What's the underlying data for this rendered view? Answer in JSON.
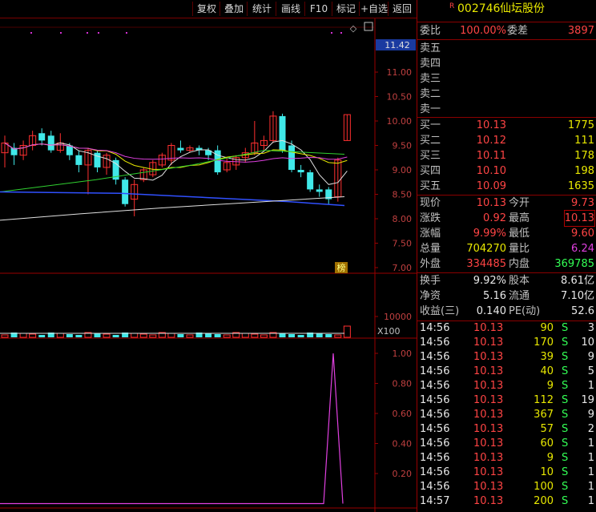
{
  "toolbar": {
    "buttons": [
      "复权",
      "叠加",
      "统计",
      "画线",
      "F10",
      "标记",
      "+自选",
      "返回"
    ]
  },
  "price_axis": {
    "current_price": "11.42",
    "ticks": [
      "11.00",
      "10.50",
      "10.00",
      "9.50",
      "9.00",
      "8.50",
      "8.00",
      "7.50",
      "7.00"
    ],
    "badge": "榜"
  },
  "volume_axis": {
    "tick": "10000",
    "unit": "X100"
  },
  "indicator_axis": {
    "ticks": [
      "1.00",
      "0.80",
      "0.60",
      "0.40",
      "0.20"
    ]
  },
  "stock": {
    "flag": "R",
    "code": "002746",
    "name": "仙坛股份"
  },
  "committee": {
    "ratio_label": "委比",
    "ratio_value": "100.00%",
    "diff_label": "委差",
    "diff_value": "3897"
  },
  "asks": [
    {
      "label": "卖五",
      "price": "",
      "vol": ""
    },
    {
      "label": "卖四",
      "price": "",
      "vol": ""
    },
    {
      "label": "卖三",
      "price": "",
      "vol": ""
    },
    {
      "label": "卖二",
      "price": "",
      "vol": ""
    },
    {
      "label": "卖一",
      "price": "",
      "vol": ""
    }
  ],
  "bids": [
    {
      "label": "买一",
      "price": "10.13",
      "vol": "1775"
    },
    {
      "label": "买二",
      "price": "10.12",
      "vol": "111"
    },
    {
      "label": "买三",
      "price": "10.11",
      "vol": "178"
    },
    {
      "label": "买四",
      "price": "10.10",
      "vol": "198"
    },
    {
      "label": "买五",
      "price": "10.09",
      "vol": "1635"
    }
  ],
  "quote": [
    {
      "l1": "现价",
      "v1": "10.13",
      "l2": "今开",
      "v2": "9.73"
    },
    {
      "l1": "涨跌",
      "v1": "0.92",
      "l2": "最高",
      "v2": "10.13"
    },
    {
      "l1": "涨幅",
      "v1": "9.99%",
      "l2": "最低",
      "v2": "9.60"
    },
    {
      "l1": "总量",
      "v1": "704270",
      "l2": "量比",
      "v2": "6.24"
    },
    {
      "l1": "外盘",
      "v1": "334485",
      "l2": "内盘",
      "v2": "369785"
    }
  ],
  "fundamentals": [
    {
      "l1": "换手",
      "v1": "9.92%",
      "l2": "股本",
      "v2": "8.61亿"
    },
    {
      "l1": "净资",
      "v1": "5.16",
      "l2": "流通",
      "v2": "7.10亿"
    },
    {
      "l1": "收益(三)",
      "v1": "0.140",
      "l2": "PE(动)",
      "v2": "52.6"
    }
  ],
  "ticks": [
    {
      "time": "14:56",
      "price": "10.13",
      "vol": "90",
      "side": "S",
      "n": "3"
    },
    {
      "time": "14:56",
      "price": "10.13",
      "vol": "170",
      "side": "S",
      "n": "10"
    },
    {
      "time": "14:56",
      "price": "10.13",
      "vol": "39",
      "side": "S",
      "n": "9"
    },
    {
      "time": "14:56",
      "price": "10.13",
      "vol": "40",
      "side": "S",
      "n": "5"
    },
    {
      "time": "14:56",
      "price": "10.13",
      "vol": "9",
      "side": "S",
      "n": "1"
    },
    {
      "time": "14:56",
      "price": "10.13",
      "vol": "112",
      "side": "S",
      "n": "19"
    },
    {
      "time": "14:56",
      "price": "10.13",
      "vol": "367",
      "side": "S",
      "n": "9"
    },
    {
      "time": "14:56",
      "price": "10.13",
      "vol": "57",
      "side": "S",
      "n": "2"
    },
    {
      "time": "14:56",
      "price": "10.13",
      "vol": "60",
      "side": "S",
      "n": "1"
    },
    {
      "time": "14:56",
      "price": "10.13",
      "vol": "9",
      "side": "S",
      "n": "1"
    },
    {
      "time": "14:56",
      "price": "10.13",
      "vol": "10",
      "side": "S",
      "n": "1"
    },
    {
      "time": "14:56",
      "price": "10.13",
      "vol": "100",
      "side": "S",
      "n": "1"
    },
    {
      "time": "14:57",
      "price": "10.13",
      "vol": "200",
      "side": "S",
      "n": "1"
    }
  ],
  "candles": [
    {
      "o": 9.35,
      "c": 9.55,
      "h": 9.7,
      "l": 9.05
    },
    {
      "o": 9.45,
      "c": 9.3,
      "h": 9.55,
      "l": 9.1
    },
    {
      "o": 9.3,
      "c": 9.5,
      "h": 9.6,
      "l": 9.2
    },
    {
      "o": 9.5,
      "c": 9.7,
      "h": 9.8,
      "l": 9.4
    },
    {
      "o": 9.75,
      "c": 9.6,
      "h": 9.85,
      "l": 9.5
    },
    {
      "o": 9.7,
      "c": 9.4,
      "h": 9.8,
      "l": 9.35
    },
    {
      "o": 9.4,
      "c": 9.55,
      "h": 9.75,
      "l": 9.35
    },
    {
      "o": 9.5,
      "c": 9.3,
      "h": 9.55,
      "l": 9.2
    },
    {
      "o": 9.3,
      "c": 9.1,
      "h": 9.4,
      "l": 8.95
    },
    {
      "o": 9.1,
      "c": 9.4,
      "h": 9.45,
      "l": 8.5
    },
    {
      "o": 9.35,
      "c": 9.05,
      "h": 9.4,
      "l": 8.95
    },
    {
      "o": 9.05,
      "c": 9.3,
      "h": 9.35,
      "l": 8.9
    },
    {
      "o": 9.2,
      "c": 8.8,
      "h": 9.25,
      "l": 8.7
    },
    {
      "o": 8.8,
      "c": 8.3,
      "h": 8.85,
      "l": 8.25
    },
    {
      "o": 8.4,
      "c": 8.7,
      "h": 8.8,
      "l": 8.05
    },
    {
      "o": 8.8,
      "c": 9.0,
      "h": 9.05,
      "l": 8.75
    },
    {
      "o": 8.9,
      "c": 9.15,
      "h": 9.2,
      "l": 8.85
    },
    {
      "o": 9.1,
      "c": 9.3,
      "h": 9.35,
      "l": 9.05
    },
    {
      "o": 9.2,
      "c": 9.5,
      "h": 9.55,
      "l": 9.1
    },
    {
      "o": 9.45,
      "c": 9.4,
      "h": 9.6,
      "l": 9.35
    },
    {
      "o": 9.4,
      "c": 9.45,
      "h": 9.5,
      "l": 9.35
    },
    {
      "o": 9.45,
      "c": 9.4,
      "h": 9.5,
      "l": 9.3
    },
    {
      "o": 9.4,
      "c": 9.3,
      "h": 9.45,
      "l": 9.2
    },
    {
      "o": 9.4,
      "c": 8.95,
      "h": 9.5,
      "l": 8.9
    },
    {
      "o": 9.0,
      "c": 9.15,
      "h": 9.25,
      "l": 8.95
    },
    {
      "o": 9.1,
      "c": 9.25,
      "h": 9.3,
      "l": 9.0
    },
    {
      "o": 9.25,
      "c": 9.35,
      "h": 9.45,
      "l": 9.15
    },
    {
      "o": 9.35,
      "c": 9.55,
      "h": 10.0,
      "l": 9.3
    },
    {
      "o": 9.5,
      "c": 9.6,
      "h": 9.7,
      "l": 9.4
    },
    {
      "o": 9.6,
      "c": 10.1,
      "h": 10.2,
      "l": 9.55
    },
    {
      "o": 10.1,
      "c": 9.4,
      "h": 10.15,
      "l": 9.35
    },
    {
      "o": 9.5,
      "c": 9.0,
      "h": 9.6,
      "l": 8.95
    },
    {
      "o": 9.0,
      "c": 8.95,
      "h": 9.1,
      "l": 8.85
    },
    {
      "o": 8.95,
      "c": 8.6,
      "h": 9.0,
      "l": 8.55
    },
    {
      "o": 8.6,
      "c": 8.55,
      "h": 8.7,
      "l": 8.45
    },
    {
      "o": 8.6,
      "c": 8.4,
      "h": 8.65,
      "l": 8.3
    },
    {
      "o": 8.45,
      "c": 9.2,
      "h": 9.25,
      "l": 8.35
    },
    {
      "o": 9.6,
      "c": 10.13,
      "h": 10.13,
      "l": 9.6
    }
  ]
}
